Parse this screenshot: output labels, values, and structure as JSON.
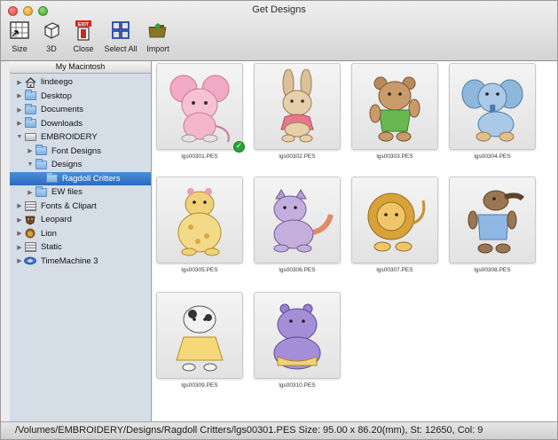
{
  "window": {
    "title": "Get Designs"
  },
  "toolbar": {
    "items": [
      {
        "label": "Size",
        "icon": "size-grid-icon"
      },
      {
        "label": "3D",
        "icon": "cube-icon"
      },
      {
        "label": "Close",
        "icon": "exit-door-icon",
        "badge": "EXIT"
      },
      {
        "label": "Select All",
        "icon": "select-all-grid-icon"
      },
      {
        "label": "Import",
        "icon": "folder-import-icon"
      }
    ]
  },
  "sidebar": {
    "header": "My Macintosh",
    "items": [
      {
        "label": "lindeego",
        "icon": "home-icon"
      },
      {
        "label": "Desktop",
        "icon": "folder-icon"
      },
      {
        "label": "Documents",
        "icon": "folder-icon"
      },
      {
        "label": "Downloads",
        "icon": "folder-icon"
      },
      {
        "label": "EMBROIDERY",
        "icon": "drive-icon",
        "expanded": true
      },
      {
        "label": "Font Designs",
        "icon": "folder-icon"
      },
      {
        "label": "Designs",
        "icon": "folder-icon",
        "expanded": true
      },
      {
        "label": "Ragdoll Critters",
        "icon": "folder-icon",
        "selected": true
      },
      {
        "label": "EW files",
        "icon": "folder-icon"
      },
      {
        "label": "Fonts & Clipart",
        "icon": "disk-stack-icon"
      },
      {
        "label": "Leopard",
        "icon": "leopard-drive-icon"
      },
      {
        "label": "Lion",
        "icon": "lion-drive-icon"
      },
      {
        "label": "Static",
        "icon": "disk-stack-icon"
      },
      {
        "label": "TimeMachine 3",
        "icon": "time-machine-icon"
      }
    ]
  },
  "designs": [
    {
      "file": "lgs00301.PES",
      "subject": "mouse",
      "selected": true
    },
    {
      "file": "lgs00302.PES",
      "subject": "bunny"
    },
    {
      "file": "lgs00303.PES",
      "subject": "bear"
    },
    {
      "file": "lgs00304.PES",
      "subject": "elephant"
    },
    {
      "file": "lgs00305.PES",
      "subject": "giraffe"
    },
    {
      "file": "lgs00306.PES",
      "subject": "cat"
    },
    {
      "file": "lgs00307.PES",
      "subject": "lion"
    },
    {
      "file": "lgs00308.PES",
      "subject": "anteater"
    },
    {
      "file": "lgs00309.PES",
      "subject": "cow"
    },
    {
      "file": "lgs00310.PES",
      "subject": "hippo"
    }
  ],
  "status": {
    "text": "/Volumes/EMBROIDERY/Designs/Ragdoll Critters/lgs00301.PES Size: 95.00 x 86.20(mm), St: 12650, Col: 9"
  }
}
